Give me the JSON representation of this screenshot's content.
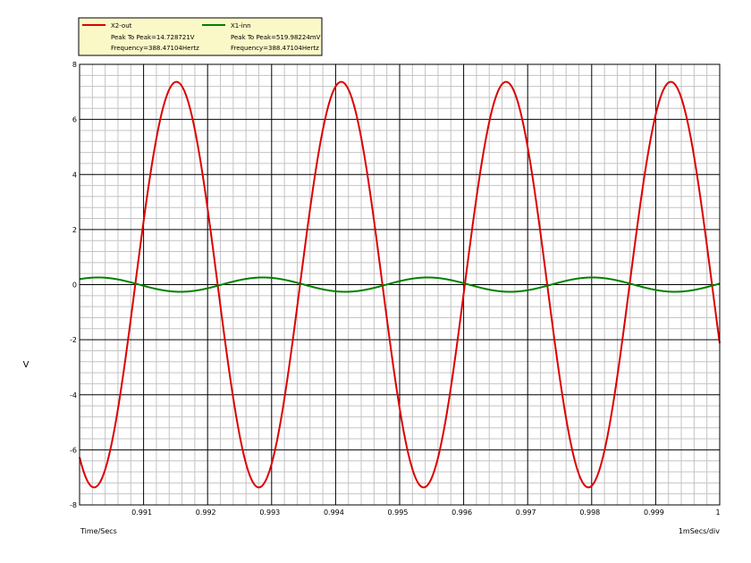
{
  "chart_data": {
    "type": "line",
    "xlabel": "Time/Secs",
    "ylabel": "V",
    "x_scale_note": "1mSecs/div",
    "xlim": [
      0.99,
      1.0
    ],
    "ylim": [
      -8,
      8
    ],
    "x_major_ticks": [
      0.991,
      0.992,
      0.993,
      0.994,
      0.995,
      0.996,
      0.997,
      0.998,
      0.999,
      1.0
    ],
    "x_tick_labels": [
      "0.991",
      "0.992",
      "0.993",
      "0.994",
      "0.995",
      "0.996",
      "0.997",
      "0.998",
      "0.999",
      "1"
    ],
    "y_major_ticks": [
      -8,
      -6,
      -4,
      -2,
      0,
      2,
      4,
      6,
      8
    ],
    "y_tick_labels": [
      "-8",
      "-6",
      "-4",
      "-2",
      "0",
      "2",
      "4",
      "6",
      "8"
    ],
    "x_minor_step": 0.0002,
    "y_minor_step": 0.4,
    "grid": true,
    "legend_placement": "top-left",
    "series": [
      {
        "name": "X2-out",
        "color": "#dd0000",
        "peak_to_peak_label": "Peak To Peak=14.728721V",
        "frequency_label": "Frequency=388.47104Hertz",
        "amplitude": 7.364,
        "frequency_hz": 388.47104,
        "phase_zero_cross_rising": 0.99087
      },
      {
        "name": "X1-inn",
        "color": "#008000",
        "peak_to_peak_label": "Peak To Peak=519.98224mV",
        "frequency_label": "Frequency=388.47104Hertz",
        "amplitude": 0.26,
        "frequency_hz": 388.47104,
        "phase_zero_cross_rising": 0.99222
      }
    ]
  }
}
